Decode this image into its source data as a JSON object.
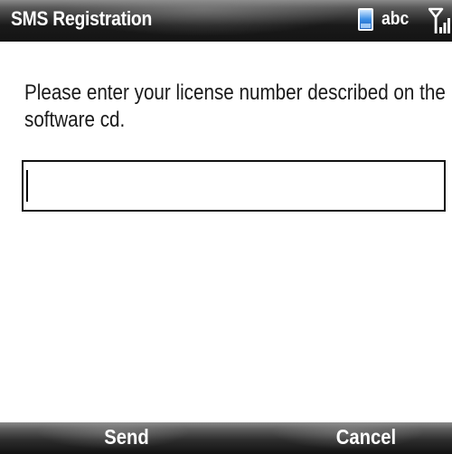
{
  "titlebar": {
    "title": "SMS Registration",
    "input_mode": "abc",
    "icons": [
      "device-icon",
      "signal-icon"
    ]
  },
  "main": {
    "prompt": "Please enter your license number described on the software cd.",
    "license_input": {
      "value": "",
      "placeholder": ""
    }
  },
  "softkeys": {
    "left_label": "Send",
    "right_label": "Cancel"
  },
  "colors": {
    "bar_dark": "#141414",
    "bar_light": "#8a8a8a",
    "text": "#1a1a1a",
    "device_icon_blue": "#3a8ee6"
  }
}
